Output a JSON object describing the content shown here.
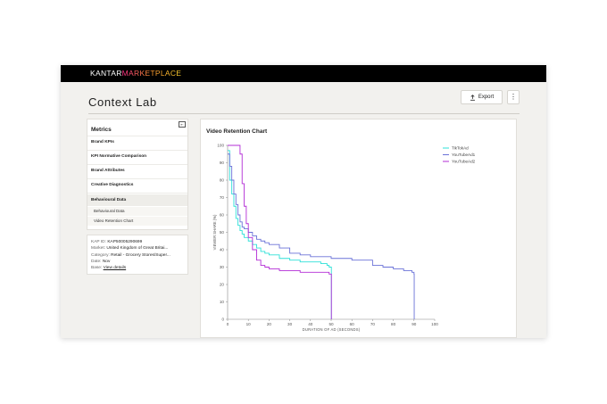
{
  "brand": {
    "part1": "KANTAR",
    "part2": "MARKETPLACE"
  },
  "page": {
    "title": "Context Lab"
  },
  "toolbar": {
    "export_label": "Export",
    "more_label": "⋮"
  },
  "metrics": {
    "title": "Metrics",
    "items": [
      "Brand KPIs",
      "KPI Normative Comparison",
      "Brand Attributes",
      "Creative Diagnostics"
    ],
    "active": "Behavioural Data",
    "subitems": [
      "Behavioural Data",
      "Video Retention Chart"
    ]
  },
  "info": {
    "kap_label": "KAP ID:",
    "kap_value": "KAP50005290699",
    "market_label": "Market:",
    "market_value": "United Kingdom of Great Britai...",
    "category_label": "Category:",
    "category_value": "Retail - Grocery Stores/Super...",
    "date_label": "Date:",
    "date_value": "Nov",
    "base_label": "Base:",
    "base_link": "View details"
  },
  "chart_data": {
    "type": "line",
    "title": "Video Retention Chart",
    "xlabel": "DURATION OF AD (SECONDS)",
    "ylabel": "VIEWER SHARE (%)",
    "xlim": [
      0,
      100
    ],
    "ylim": [
      0,
      100
    ],
    "xticks": [
      0,
      10,
      20,
      30,
      40,
      50,
      60,
      70,
      80,
      90,
      100
    ],
    "yticks": [
      0,
      10,
      20,
      30,
      40,
      50,
      60,
      70,
      80,
      90,
      100
    ],
    "legend_position": "top-right",
    "series": [
      {
        "name": "TikTokAd",
        "color": "#2de0d8",
        "x": [
          0,
          1,
          2,
          3,
          4,
          5,
          6,
          7,
          8,
          10,
          12,
          14,
          16,
          18,
          20,
          25,
          30,
          35,
          40,
          45,
          48,
          49,
          50,
          50.1
        ],
        "y": [
          97,
          80,
          72,
          65,
          58,
          54,
          51,
          49,
          47,
          45,
          43,
          41,
          39,
          38,
          37,
          35,
          34,
          33,
          33,
          32,
          31,
          30,
          30,
          0
        ]
      },
      {
        "name": "YouTubeAd1",
        "color": "#6a72d8",
        "x": [
          0,
          1,
          2,
          3,
          4,
          5,
          6,
          7,
          8,
          10,
          12,
          14,
          16,
          18,
          20,
          25,
          30,
          35,
          40,
          50,
          60,
          70,
          75,
          80,
          85,
          89,
          90,
          90.1
        ],
        "y": [
          95,
          88,
          80,
          72,
          66,
          60,
          56,
          53,
          52,
          50,
          48,
          46,
          45,
          44,
          43,
          41,
          38,
          37,
          36,
          35,
          34,
          31,
          30,
          29,
          28,
          27,
          26,
          0
        ]
      },
      {
        "name": "YouTubeAd2",
        "color": "#b32dd6",
        "x": [
          0,
          5,
          6,
          7,
          8,
          9,
          10,
          12,
          14,
          16,
          18,
          20,
          25,
          30,
          35,
          40,
          45,
          49,
          50,
          50.1
        ],
        "y": [
          100,
          100,
          95,
          78,
          65,
          55,
          47,
          40,
          34,
          31,
          30,
          29,
          28,
          28,
          27,
          27,
          27,
          26,
          26,
          0
        ]
      }
    ]
  }
}
